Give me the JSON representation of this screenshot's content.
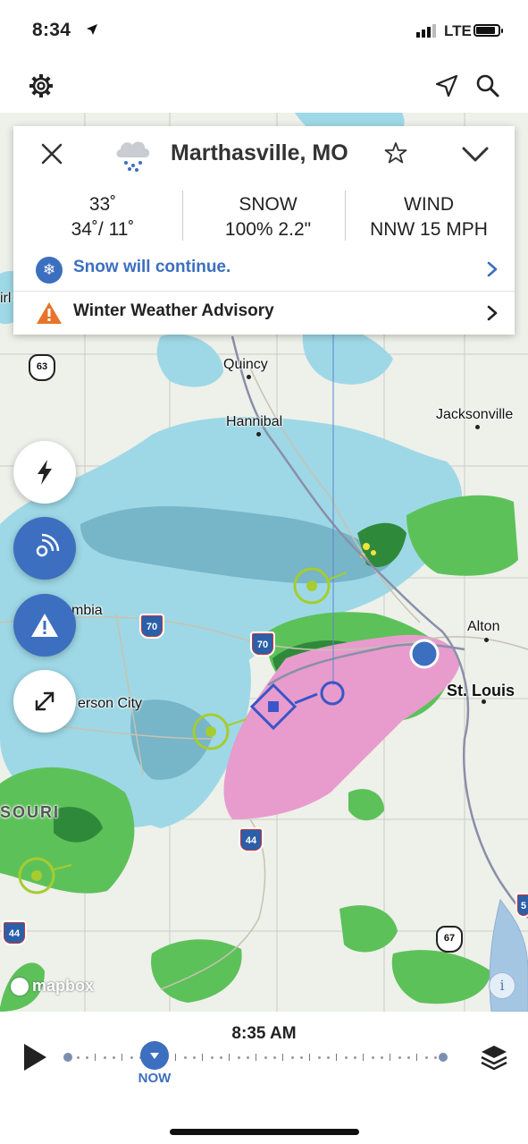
{
  "status_bar": {
    "time": "8:34",
    "network": "LTE"
  },
  "toolbar": {
    "settings_icon": "gear-icon",
    "location_icon": "navigation-arrow-icon",
    "search_icon": "search-icon"
  },
  "card": {
    "location": "Marthasville, MO",
    "temp_now": "33˚",
    "temp_hilo": "34˚/ 11˚",
    "precip_label": "SNOW",
    "precip_value": "100% 2.2\"",
    "wind_label": "WIND",
    "wind_value": "NNW 15 MPH",
    "forecast_text": "Snow will continue.",
    "alert_text": "Winter Weather Advisory",
    "accent_color": "#3d6fc0",
    "alert_color": "#e8742a"
  },
  "map": {
    "cities": {
      "quincy": "Quincy",
      "hannibal": "Hannibal",
      "jacksonville": "Jacksonville",
      "columbia": "mbia",
      "jefferson_city": "erson City",
      "alton": "Alton",
      "st_louis": "St. Louis",
      "missouri": "SOURI",
      "edge_label": "irl"
    },
    "shields": {
      "us63": "63",
      "i70_west": "70",
      "i70_east": "70",
      "i44_center": "44",
      "i44_west": "44",
      "us67": "67",
      "edge_shield": "5"
    },
    "attribution": "mapbox",
    "info": "i"
  },
  "fabs": [
    "lightning-icon",
    "radar-icon",
    "alert-icon",
    "expand-icon"
  ],
  "timeline": {
    "time": "8:35 AM",
    "now_label": "NOW"
  }
}
